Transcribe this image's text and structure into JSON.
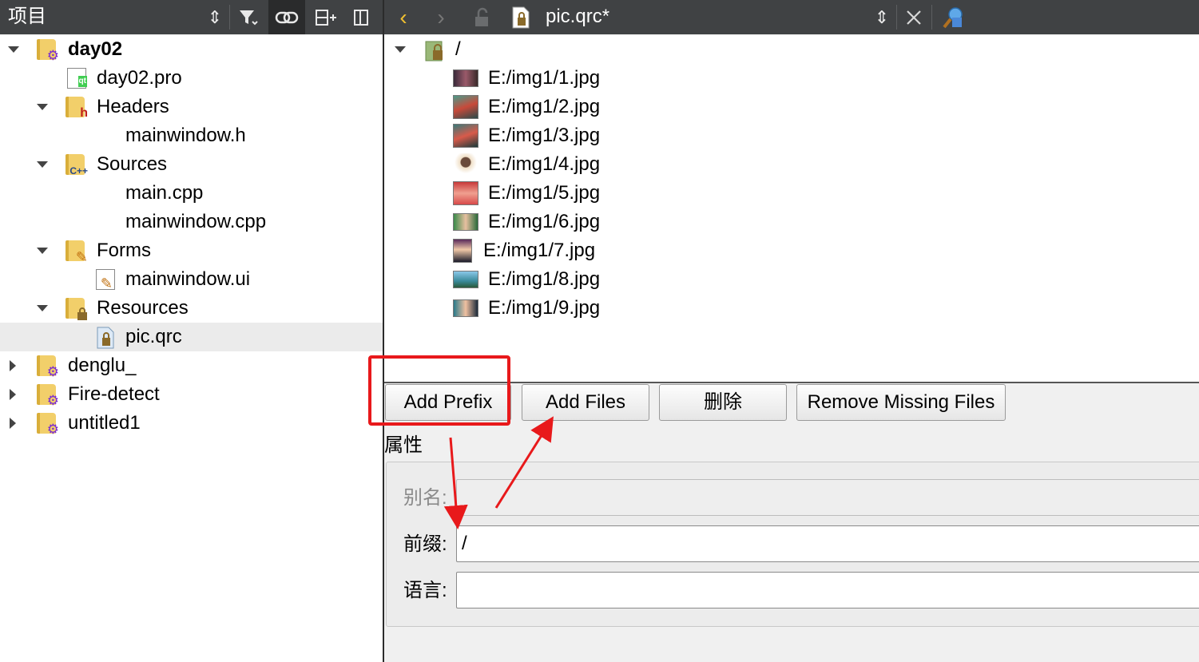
{
  "project_panel": {
    "title": "项目",
    "toolbar_icons": [
      "sort-icon",
      "filter-icon",
      "link-icon",
      "split-add-icon",
      "close-sidebar-icon"
    ]
  },
  "tree": {
    "items": [
      {
        "label": "day02",
        "kind": "project"
      },
      {
        "label": "day02.pro",
        "kind": "pro-file"
      },
      {
        "label": "Headers",
        "kind": "headers-folder"
      },
      {
        "label": "mainwindow.h",
        "kind": "file"
      },
      {
        "label": "Sources",
        "kind": "sources-folder"
      },
      {
        "label": "main.cpp",
        "kind": "file"
      },
      {
        "label": "mainwindow.cpp",
        "kind": "file"
      },
      {
        "label": "Forms",
        "kind": "forms-folder"
      },
      {
        "label": "mainwindow.ui",
        "kind": "ui-file"
      },
      {
        "label": "Resources",
        "kind": "resources-folder"
      },
      {
        "label": "pic.qrc",
        "kind": "qrc-file",
        "selected": true
      },
      {
        "label": "denglu_",
        "kind": "project"
      },
      {
        "label": "Fire-detect",
        "kind": "project"
      },
      {
        "label": "untitled1",
        "kind": "project"
      }
    ]
  },
  "editor": {
    "file_name": "pic.qrc*",
    "toolbar_icons": [
      "back-icon",
      "forward-icon",
      "lock-icon",
      "qrc-file-icon",
      "updown-icon",
      "close-icon",
      "locator-icon"
    ]
  },
  "resources": {
    "prefix": "/",
    "files": [
      "E:/img1/1.jpg",
      "E:/img1/2.jpg",
      "E:/img1/3.jpg",
      "E:/img1/4.jpg",
      "E:/img1/5.jpg",
      "E:/img1/6.jpg",
      "E:/img1/7.jpg",
      "E:/img1/8.jpg",
      "E:/img1/9.jpg"
    ]
  },
  "buttons": {
    "add_prefix": "Add Prefix",
    "add_files": "Add Files",
    "delete": "删除",
    "remove_missing": "Remove Missing Files"
  },
  "properties": {
    "group_title": "属性",
    "alias_label": "别名:",
    "alias_value": "",
    "prefix_label": "前缀:",
    "prefix_value": "/",
    "language_label": "语言:",
    "language_value": ""
  },
  "colors": {
    "toolbar_bg": "#404244",
    "annotation_red": "#e8191b",
    "folder_yellow": "#f2cf6a",
    "selection_bg": "#ebebeb"
  }
}
